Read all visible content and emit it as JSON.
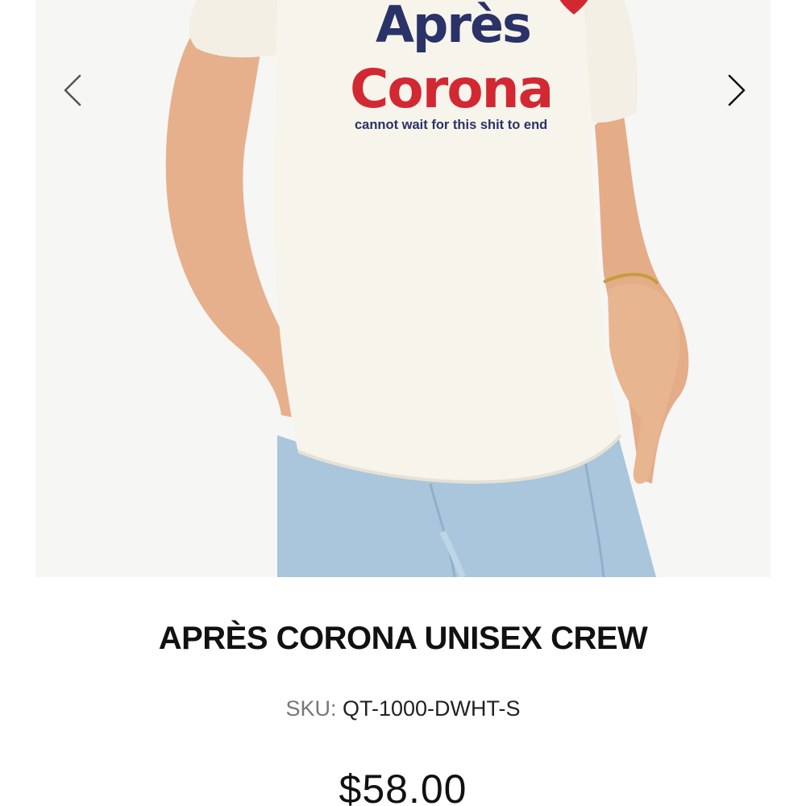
{
  "product": {
    "title": "APRÈS CORONA UNISEX CREW",
    "sku_label": "SKU:",
    "sku_value": "QT-1000-DWHT-S",
    "price": "$58.00"
  },
  "shirt_print": {
    "line1": "Après",
    "line2": "Corona",
    "line3": "cannot wait for this shit to end"
  },
  "gallery": {
    "prev_icon": "chevron-left-icon",
    "next_icon": "chevron-right-icon"
  },
  "colors": {
    "print_navy": "#2a3268",
    "print_red": "#d22832",
    "shirt": "#f7f4ec",
    "denim": "#a9c6dc"
  }
}
